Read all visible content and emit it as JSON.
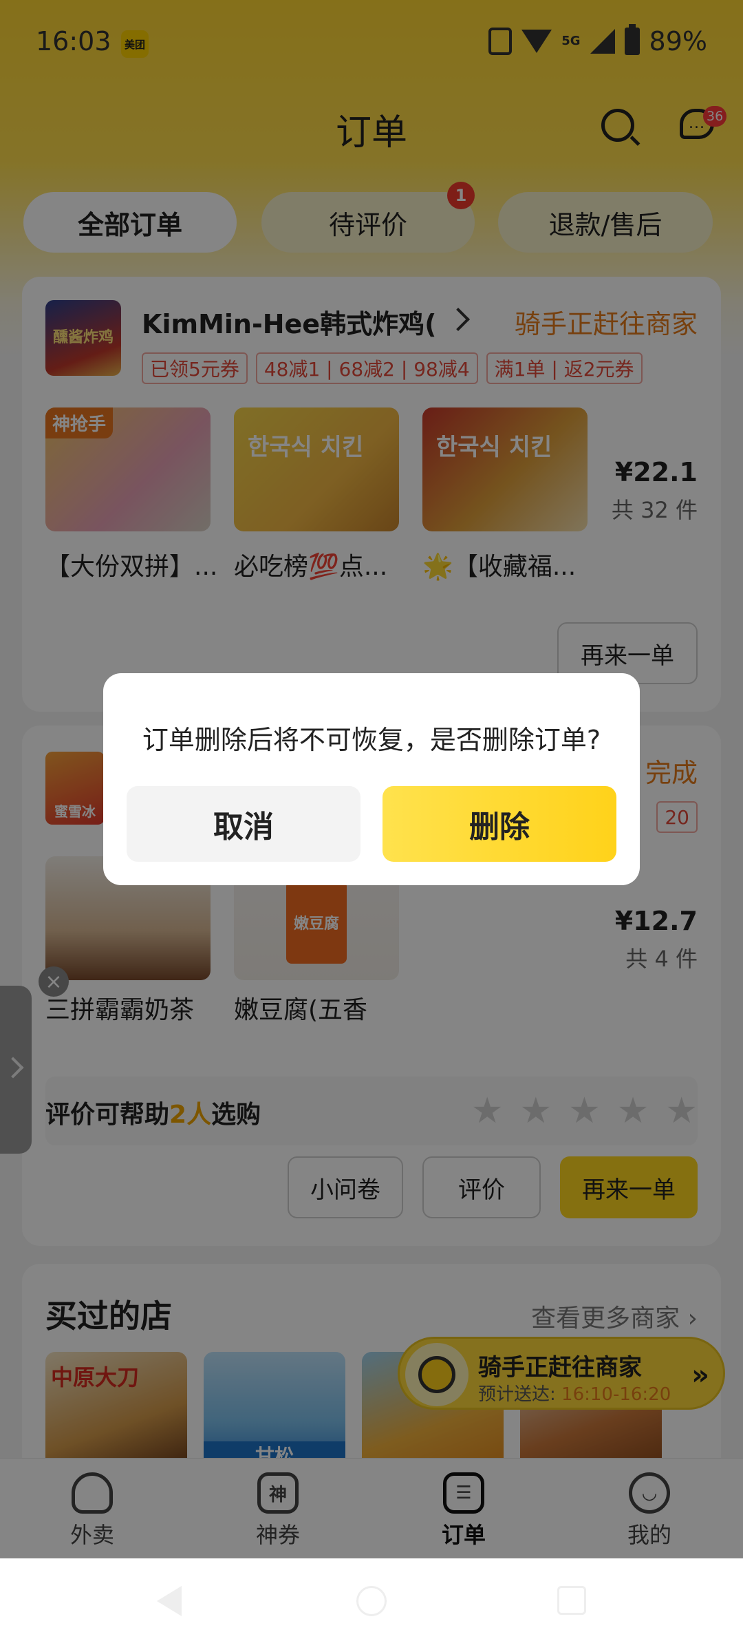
{
  "status_bar": {
    "time": "16:03",
    "app_badge": "美团",
    "network": "5G",
    "battery": "89%"
  },
  "header": {
    "title": "订单",
    "message_badge": "36"
  },
  "tabs": [
    {
      "label": "全部订单",
      "active": true
    },
    {
      "label": "待评价",
      "badge": "1"
    },
    {
      "label": "退款/售后"
    }
  ],
  "order1": {
    "shop_logo_text": "醺酱炸鸡",
    "shop_name": "KimMin-Hee韩式炸鸡(",
    "status": "骑手正赶往商家",
    "tags": [
      "已领5元券",
      "48减1",
      "68减2",
      "98减4",
      "满1单",
      "返2元券"
    ],
    "items": [
      {
        "name": "【大份双拼】...",
        "img_text": "神抢手"
      },
      {
        "name": "必吃榜💯点...",
        "img_text": "한국식 치킨"
      },
      {
        "name": "🌟【收藏福...",
        "img_text": "한국식 치킨"
      }
    ],
    "price": "¥22.1",
    "quantity": "共 32 件",
    "reorder_label": "再来一单"
  },
  "order2": {
    "status_partial": "完成",
    "tag_partial": "20",
    "logo_text": "蜜雪冰",
    "items": [
      {
        "name": "三拼霸霸奶茶"
      },
      {
        "name": "嫩豆腐(五香",
        "img_text": "嫩豆腐"
      }
    ],
    "price": "¥12.7",
    "quantity": "共 4 件",
    "review_prompt_pre": "评价可帮助",
    "review_prompt_hl": "2人",
    "review_prompt_post": "选购",
    "stars": [
      "★",
      "★",
      "★",
      "★",
      "★"
    ],
    "survey_label": "小问卷",
    "review_label": "评价",
    "reorder_label": "再来一单"
  },
  "bought_shops": {
    "title": "买过的店",
    "more_link": "查看更多商家",
    "thumbs": [
      {
        "text": "中原大刀"
      },
      {
        "text": "甘松"
      },
      {
        "text": ""
      },
      {
        "text": ""
      }
    ]
  },
  "rider_float": {
    "title": "骑手正赶往商家",
    "eta_label": "预计送达:",
    "eta_time": "16:10-16:20"
  },
  "bottom_nav": [
    {
      "label": "外卖",
      "icon_char": ""
    },
    {
      "label": "神券",
      "icon_char": "神"
    },
    {
      "label": "订单",
      "icon_char": "☰",
      "active": true
    },
    {
      "label": "我的",
      "icon_char": "◡"
    }
  ],
  "dialog": {
    "message": "订单删除后将不可恢复，是否删除订单?",
    "cancel_label": "取消",
    "delete_label": "删除"
  },
  "colors": {
    "brand_yellow": "#ffd61f",
    "status_orange": "#e57b1c",
    "tag_red": "#e24a3b"
  }
}
